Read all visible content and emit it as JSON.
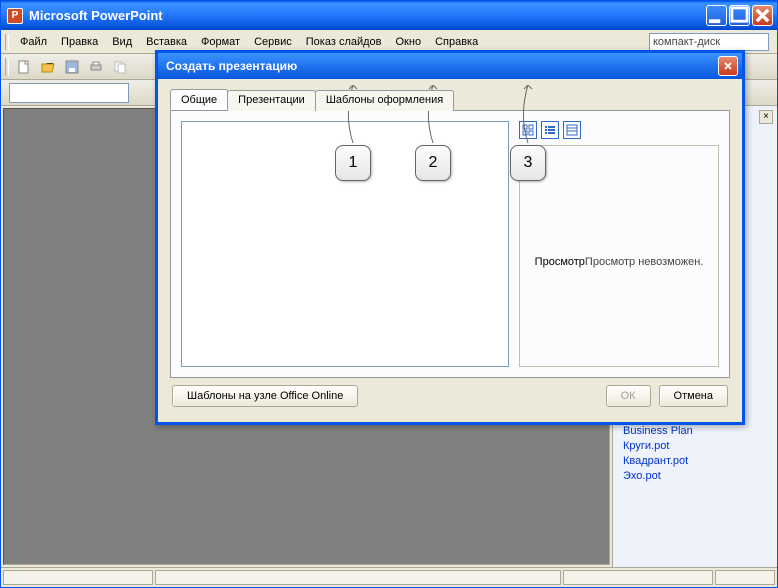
{
  "app": {
    "title": "Microsoft PowerPoint",
    "icon_letter": "P"
  },
  "menubar": {
    "items": [
      "Файл",
      "Правка",
      "Вид",
      "Вставка",
      "Формат",
      "Сервис",
      "Показ слайдов",
      "Окно",
      "Справка"
    ],
    "help_placeholder": "компакт-диск"
  },
  "task_pane": {
    "links": [
      "Business Plan",
      "Круги.pot",
      "Квадрант.pot",
      "Эхо.pot"
    ]
  },
  "dialog": {
    "title": "Создать презентацию",
    "tabs": [
      "Общие",
      "Презентации",
      "Шаблоны оформления"
    ],
    "preview_label": "Просмотр",
    "preview_text": "Просмотр невозможен.",
    "templates_online": "Шаблоны на узле Office Online",
    "ok": "ОК",
    "cancel": "Отмена"
  },
  "callouts": [
    "1",
    "2",
    "3"
  ]
}
